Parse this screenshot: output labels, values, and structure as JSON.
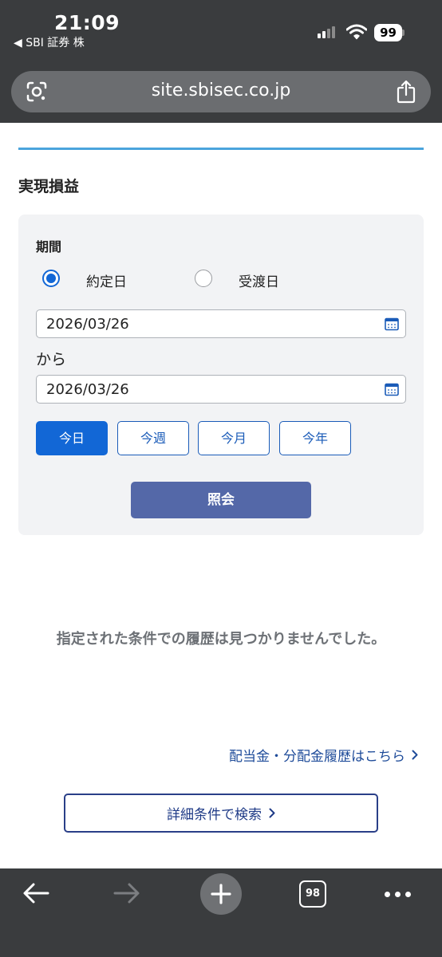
{
  "status_bar": {
    "time": "21:09",
    "back_app": "◀ SBI 証券 株",
    "battery": "99"
  },
  "browser": {
    "url": "site.sbisec.co.jp",
    "tab_count": "98"
  },
  "page": {
    "section_title": "実現損益",
    "period_label": "期間",
    "radio_options": [
      {
        "label": "約定日",
        "selected": true
      },
      {
        "label": "受渡日",
        "selected": false
      }
    ],
    "date_from": "2026/03/26",
    "range_word": "から",
    "date_to": "2026/03/26",
    "quick_buttons": [
      {
        "label": "今日",
        "active": true
      },
      {
        "label": "今週",
        "active": false
      },
      {
        "label": "今月",
        "active": false
      },
      {
        "label": "今年",
        "active": false
      }
    ],
    "submit_label": "照会",
    "empty_message": "指定された条件での履歴は見つかりませんでした。",
    "dividend_link": "配当金・分配金履歴はこちら",
    "detail_search": "詳細条件で検索"
  },
  "colors": {
    "primary_blue": "#1267d6",
    "submit_button": "#5468a8",
    "accent_line": "#4aa4dc",
    "chrome_bg": "#3a3c3e",
    "link_navy": "#1f4c9a"
  }
}
